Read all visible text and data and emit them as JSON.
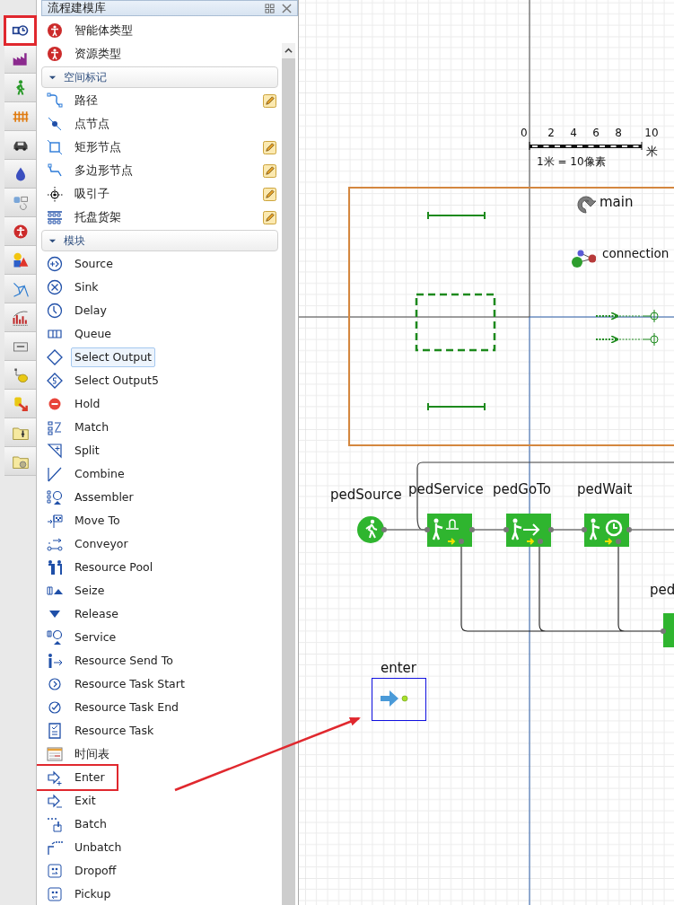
{
  "toolbar": {
    "items": [
      {
        "selected": true,
        "marked": true
      },
      {
        "selected": false,
        "marked": false
      },
      {
        "selected": false,
        "marked": false
      },
      {
        "selected": false,
        "marked": false
      },
      {
        "selected": false,
        "marked": false
      },
      {
        "selected": false,
        "marked": false
      },
      {
        "selected": false,
        "marked": false
      },
      {
        "selected": false,
        "marked": false
      },
      {
        "selected": false,
        "marked": false
      },
      {
        "selected": false,
        "marked": false
      },
      {
        "selected": false,
        "marked": false
      },
      {
        "selected": false,
        "marked": false
      },
      {
        "selected": false,
        "marked": false
      },
      {
        "selected": false,
        "marked": false
      },
      {
        "selected": false,
        "marked": false
      },
      {
        "selected": false,
        "marked": false
      }
    ]
  },
  "palette": {
    "title": "流程建模库",
    "agent_types": [
      {
        "label": "智能体类型"
      },
      {
        "label": "资源类型"
      }
    ],
    "sections": [
      {
        "title": "空间标记",
        "expanded": true,
        "items": [
          {
            "label": "路径",
            "editable": true
          },
          {
            "label": "点节点",
            "editable": false
          },
          {
            "label": "矩形节点",
            "editable": true
          },
          {
            "label": "多边形节点",
            "editable": true
          },
          {
            "label": "吸引子",
            "editable": true
          },
          {
            "label": "托盘货架",
            "editable": true
          }
        ]
      },
      {
        "title": "模块",
        "expanded": true,
        "items": [
          {
            "label": "Source",
            "selected": false,
            "marked": false
          },
          {
            "label": "Sink",
            "selected": false,
            "marked": false
          },
          {
            "label": "Delay",
            "selected": false,
            "marked": false
          },
          {
            "label": "Queue",
            "selected": false,
            "marked": false
          },
          {
            "label": "Select Output",
            "selected": true,
            "marked": false
          },
          {
            "label": "Select Output5",
            "selected": false,
            "marked": false
          },
          {
            "label": "Hold",
            "selected": false,
            "marked": false
          },
          {
            "label": "Match",
            "selected": false,
            "marked": false
          },
          {
            "label": "Split",
            "selected": false,
            "marked": false
          },
          {
            "label": "Combine",
            "selected": false,
            "marked": false
          },
          {
            "label": "Assembler",
            "selected": false,
            "marked": false
          },
          {
            "label": "Move To",
            "selected": false,
            "marked": false
          },
          {
            "label": "Conveyor",
            "selected": false,
            "marked": false
          },
          {
            "label": "Resource Pool",
            "selected": false,
            "marked": false
          },
          {
            "label": "Seize",
            "selected": false,
            "marked": false
          },
          {
            "label": "Release",
            "selected": false,
            "marked": false
          },
          {
            "label": "Service",
            "selected": false,
            "marked": false
          },
          {
            "label": "Resource Send To",
            "selected": false,
            "marked": false
          },
          {
            "label": "Resource Task Start",
            "selected": false,
            "marked": false
          },
          {
            "label": "Resource Task End",
            "selected": false,
            "marked": false
          },
          {
            "label": "Resource Task",
            "selected": false,
            "marked": false
          },
          {
            "label": "时间表",
            "selected": false,
            "marked": false
          },
          {
            "label": "Enter",
            "selected": false,
            "marked": true
          },
          {
            "label": "Exit",
            "selected": false,
            "marked": false
          },
          {
            "label": "Batch",
            "selected": false,
            "marked": false
          },
          {
            "label": "Unbatch",
            "selected": false,
            "marked": false
          },
          {
            "label": "Dropoff",
            "selected": false,
            "marked": false
          },
          {
            "label": "Pickup",
            "selected": false,
            "marked": false
          }
        ]
      }
    ]
  },
  "canvas": {
    "scale": {
      "ticks": [
        "0",
        "2",
        "4",
        "6",
        "8",
        "10"
      ],
      "unit": "米",
      "caption": "1米 = 10像素"
    },
    "objects": [
      {
        "kind": "agent",
        "label": "main"
      },
      {
        "kind": "connections",
        "label": "connection"
      }
    ],
    "flow": [
      {
        "kind": "source",
        "label": "pedSource"
      },
      {
        "kind": "service",
        "label": "pedService"
      },
      {
        "kind": "goto",
        "label": "pedGoTo"
      },
      {
        "kind": "wait",
        "label": "pedWait"
      },
      {
        "kind": "other",
        "label": "ped"
      }
    ],
    "enter": {
      "label": "enter",
      "selected": true
    }
  },
  "annotation": {
    "arrow": true
  }
}
